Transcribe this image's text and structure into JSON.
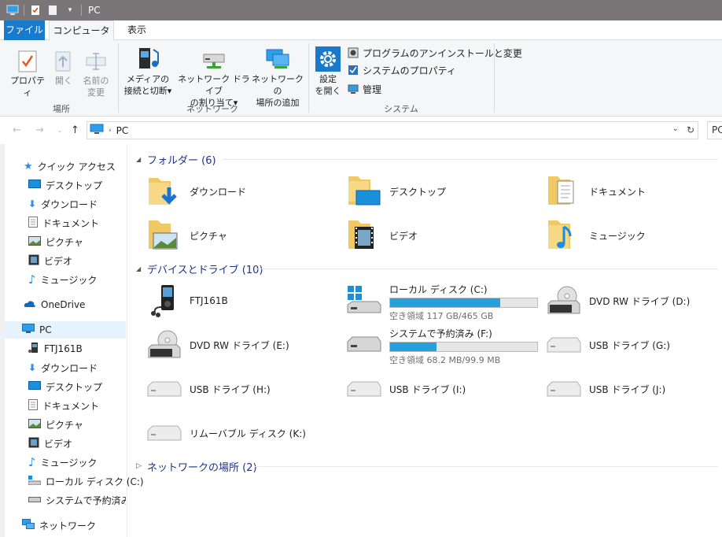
{
  "window": {
    "title": "PC"
  },
  "ribbon": {
    "tabs": {
      "file": "ファイル",
      "computer": "コンピューター",
      "view": "表示"
    },
    "location_group": {
      "label": "場所",
      "properties": "プロパティ",
      "open": "開く",
      "rename_line1": "名前の",
      "rename_line2": "変更"
    },
    "network_group": {
      "label": "ネットワーク",
      "media_line1": "メディアの",
      "media_line2": "接続と切断",
      "map_drive_line1": "ネットワーク ドライブ",
      "map_drive_line2": "の割り当て",
      "add_location_line1": "ネットワークの",
      "add_location_line2": "場所の追加"
    },
    "system_group": {
      "label": "システム",
      "settings_line1": "設定",
      "settings_line2": "を開く",
      "uninstall": "プログラムのアンインストールと変更",
      "system_properties": "システムのプロパティ",
      "manage": "管理"
    }
  },
  "address": {
    "path": "PC",
    "search_prefix": "PC"
  },
  "nav": {
    "quick_access": "クイック アクセス",
    "qa_items": [
      "デスクトップ",
      "ダウンロード",
      "ドキュメント",
      "ピクチャ",
      "ビデオ",
      "ミュージック"
    ],
    "onedrive": "OneDrive",
    "pc": "PC",
    "pc_items": [
      "FTJ161B",
      "ダウンロード",
      "デスクトップ",
      "ドキュメント",
      "ピクチャ",
      "ビデオ",
      "ミュージック",
      "ローカル ディスク (C:)",
      "システムで予約済み (F"
    ],
    "network": "ネットワーク"
  },
  "content": {
    "folders_header": "フォルダー (6)",
    "folders": [
      "ダウンロード",
      "デスクトップ",
      "ドキュメント",
      "ピクチャ",
      "ビデオ",
      "ミュージック"
    ],
    "devices_header": "デバイスとドライブ (10)",
    "devices": {
      "ftj": "FTJ161B",
      "c_name": "ローカル ディスク (C:)",
      "c_free": "空き領域 117 GB/465 GB",
      "c_used_fraction": 0.748,
      "d_name": "DVD RW ドライブ (D:)",
      "e_name": "DVD RW ドライブ (E:)",
      "f_name": "システムで予約済み (F:)",
      "f_free": "空き領域 68.2 MB/99.9 MB",
      "f_used_fraction": 0.317,
      "g_name": "USB ドライブ (G:)",
      "h_name": "USB ドライブ (H:)",
      "i_name": "USB ドライブ (I:)",
      "j_name": "USB ドライブ (J:)",
      "k_name": "リムーバブル ディスク (K:)"
    },
    "network_header": "ネットワークの場所 (2)"
  },
  "icons": {
    "dvd_label": "DVD"
  },
  "colors": {
    "accent": "#1979ca",
    "drive_bar": "#26a0da",
    "section_text": "#1e3287"
  }
}
